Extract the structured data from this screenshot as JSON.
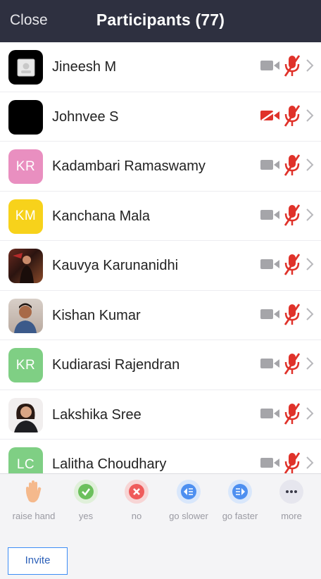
{
  "header": {
    "close_label": "Close",
    "title": "Participants (77)"
  },
  "participants": [
    {
      "name": "Jineesh M",
      "avatar_kind": "photo-placeholder",
      "video": "off",
      "audio": "muted"
    },
    {
      "name": "Johnvee S",
      "avatar_kind": "black",
      "video": "stopped",
      "audio": "muted"
    },
    {
      "name": "Kadambari Ramaswamy",
      "avatar_kind": "initials",
      "initials": "KR",
      "avatar_color": "#e98fc0",
      "video": "off",
      "audio": "muted"
    },
    {
      "name": "Kanchana Mala",
      "avatar_kind": "initials",
      "initials": "KM",
      "avatar_color": "#f7d21b",
      "video": "off",
      "audio": "muted"
    },
    {
      "name": "Kauvya Karunanidhi",
      "avatar_kind": "photo",
      "video": "off",
      "audio": "muted"
    },
    {
      "name": "Kishan Kumar",
      "avatar_kind": "photo",
      "video": "off",
      "audio": "muted"
    },
    {
      "name": "Kudiarasi Rajendran",
      "avatar_kind": "initials",
      "initials": "KR",
      "avatar_color": "#7fcf84",
      "video": "off",
      "audio": "muted"
    },
    {
      "name": "Lakshika Sree",
      "avatar_kind": "photo",
      "video": "off",
      "audio": "muted"
    },
    {
      "name": "Lalitha Choudhary",
      "avatar_kind": "initials",
      "initials": "LC",
      "avatar_color": "#7fcf84",
      "video": "off",
      "audio": "muted"
    }
  ],
  "feedback": [
    {
      "label": "raise hand",
      "icon": "raise-hand-icon"
    },
    {
      "label": "yes",
      "icon": "check-icon"
    },
    {
      "label": "no",
      "icon": "x-icon"
    },
    {
      "label": "go slower",
      "icon": "go-slower-icon"
    },
    {
      "label": "go faster",
      "icon": "go-faster-icon"
    },
    {
      "label": "more",
      "icon": "more-icon"
    }
  ],
  "invite_label": "Invite",
  "colors": {
    "header_bg": "#2e3040",
    "muted_red": "#e0322a",
    "icon_gray": "#a5a5a9",
    "accent_blue": "#3d8df5"
  }
}
